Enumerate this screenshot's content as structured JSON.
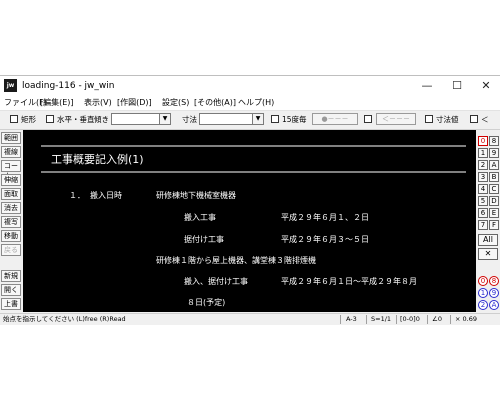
{
  "window": {
    "title": "loading-116 - jw_win",
    "app_icon": "jw"
  },
  "window_controls": {
    "minimize": "—",
    "maximize": "☐",
    "close": "✕"
  },
  "menu": [
    "ファイル(F)",
    "[編集(E)]",
    "表示(V)",
    "[作図(D)]",
    "設定(S)",
    "[その他(A)]",
    "ヘルプ(H)"
  ],
  "toolbar": {
    "rect_label": "矩形",
    "hv_label": "水平・垂直",
    "tilt_label": "傾き",
    "tilt_value": "",
    "dim_label": "寸法",
    "dim_value": "",
    "deg15_label": "15度毎",
    "dot_button": "●－－－",
    "arrow_button": "＜－－－",
    "dim_value_label": "寸法値",
    "lt_label": "＜"
  },
  "left_tools": [
    "範囲",
    "複線",
    "コーナー",
    "伸縮",
    "面取",
    "消去",
    "複写",
    "移動",
    "戻る",
    "新規",
    "開く",
    "上書"
  ],
  "right_tools": {
    "rows": [
      [
        "0",
        "8"
      ],
      [
        "1",
        "9"
      ],
      [
        "2",
        "A"
      ],
      [
        "3",
        "B"
      ],
      [
        "4",
        "C"
      ],
      [
        "5",
        "D"
      ],
      [
        "6",
        "E"
      ],
      [
        "7",
        "F"
      ]
    ],
    "all_label": "All",
    "x_label": "✕",
    "circles": [
      "0",
      "8",
      "1",
      "9",
      "2",
      "A"
    ]
  },
  "drawing": {
    "heading": "工事概要記入例(1)",
    "item_no": "１．",
    "item_label": "搬入日時",
    "line1_place": "研修棟地下機械室機器",
    "row1_label": "搬入工事",
    "row1_value": "平成２９年６月１、２日",
    "row2_label": "据付け工事",
    "row2_value": "平成２９年６月３～５日",
    "line2_place": "研修棟１階から屋上機器、講堂棟３階排煙機",
    "row3_label": "搬入、据付け工事",
    "row3_value": "平成２９年６月１日～平成２９年８月",
    "row3_cont": "８日(予定)"
  },
  "status": {
    "hint": "始点を指示してください (L)free (R)Read",
    "paper": "A-3",
    "scale": "S=1/1",
    "layer": "[0-0]0",
    "angle": "∠0",
    "zoom": "× 0.69"
  },
  "colors": {
    "canvas": "#000000",
    "drawing_text": "#ffffff",
    "accent_red": "#d00000"
  }
}
